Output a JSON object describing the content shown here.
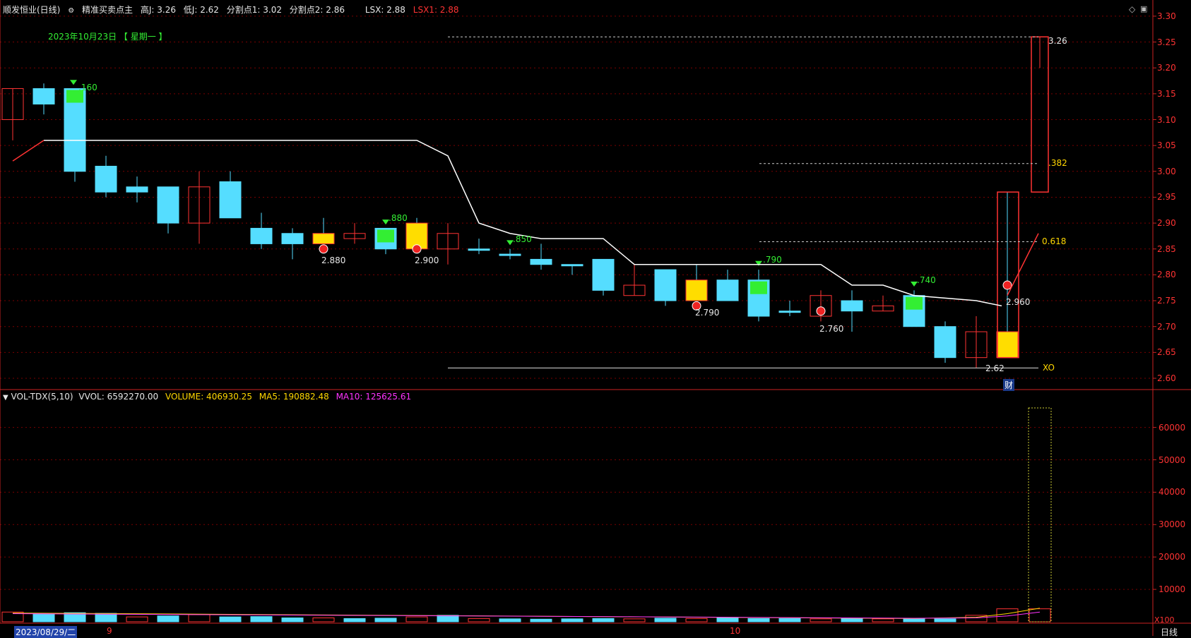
{
  "header": {
    "stock": "顺发恒业(日线)",
    "indicator": "精准买卖点主",
    "high": "高J: 3.26",
    "low": "低J: 2.62",
    "split1": "分割点1: 3.02",
    "split2": "分割点2: 2.86",
    "lsx": "LSX: 2.88",
    "lsx1": "LSX1: 2.88"
  },
  "date_banner": "2023年10月23日 【 星期一 】",
  "volume_header": {
    "name": "VOL-TDX(5,10)",
    "vvol": "VVOL: 6592270.00",
    "volume": "VOLUME: 406930.25",
    "ma5": "MA5: 190882.48",
    "ma10": "MA10: 125625.61"
  },
  "price_axis": [
    "3.30",
    "3.25",
    "3.20",
    "3.15",
    "3.10",
    "3.05",
    "3.00",
    "2.95",
    "2.90",
    "2.85",
    "2.80",
    "2.75",
    "2.70",
    "2.65",
    "2.60"
  ],
  "volume_axis": [
    "60000",
    "50000",
    "40000",
    "30000",
    "20000",
    "10000"
  ],
  "volume_unit": "X100",
  "period": "日线",
  "date_axis": {
    "start": "2023/08/29/二",
    "mark1": "9",
    "mark2": "10"
  },
  "annotations": {
    "high_marker": "3.26",
    "low_marker": "2.62",
    "fib382": ".382",
    "fib618": "0.618",
    "xo": "XO",
    "cai": "财",
    "sell_labels": [
      ".160",
      ".880",
      ".850",
      ".790",
      ".740"
    ],
    "buy_labels": [
      "2.880",
      "2.900",
      "2.790",
      "2.760",
      "2.960"
    ]
  },
  "colors": {
    "up": "#ff3333",
    "down": "#55ddff",
    "buy_fill": "#ffdd00",
    "sell_fill": "#33ee33",
    "grid": "#7a0000",
    "axis": "#cc2222"
  },
  "icons": [
    "diamond-icon",
    "window-icon"
  ]
}
